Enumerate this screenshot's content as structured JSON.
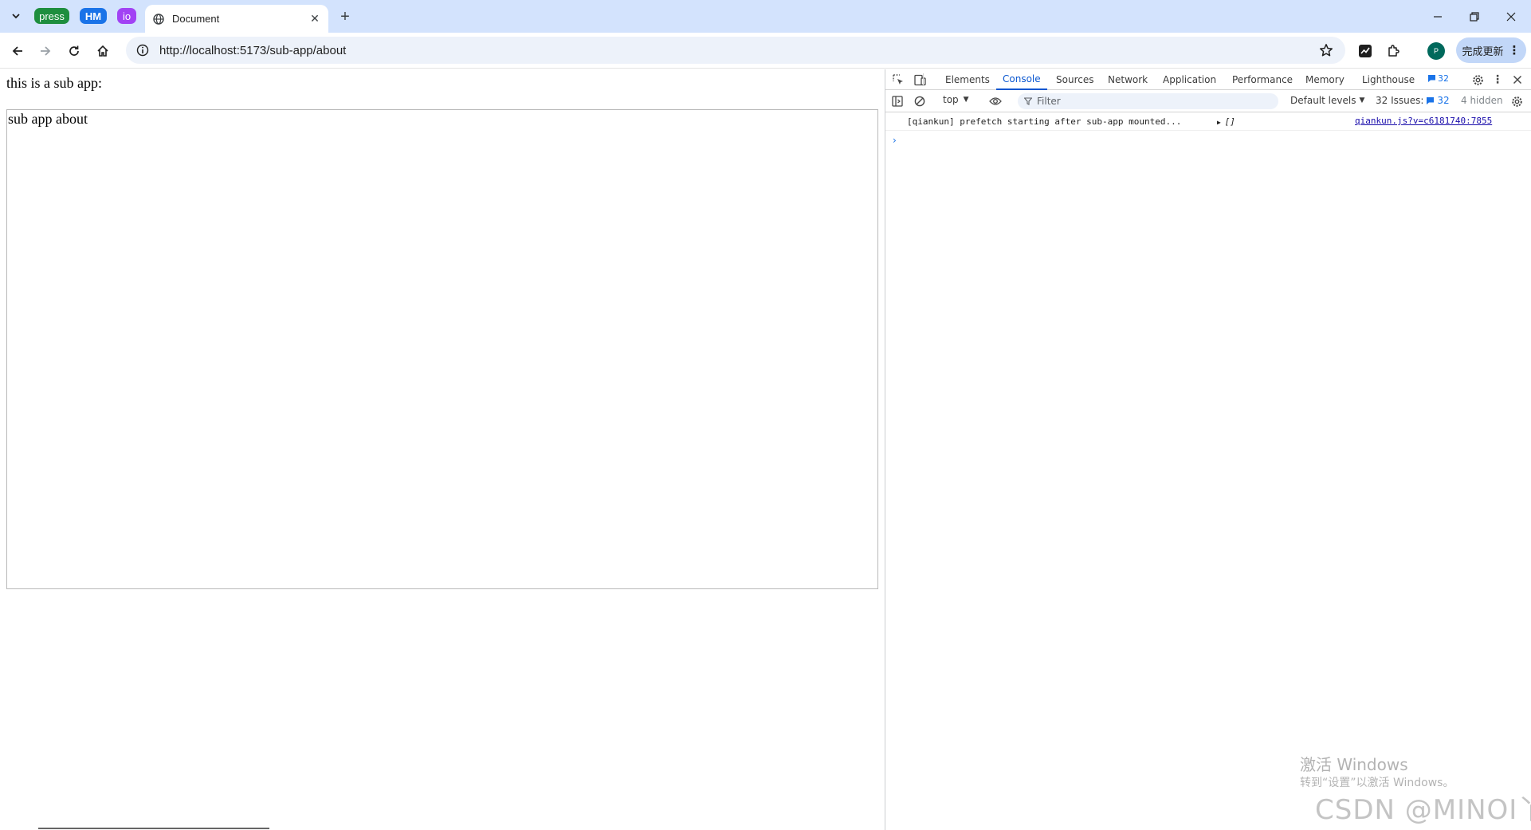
{
  "browser": {
    "pinned_tabs": [
      {
        "label": "press",
        "color": "#1e8e3e"
      },
      {
        "label": "HM",
        "color": "#1a73e8"
      },
      {
        "label": "io",
        "color": "#a142f4"
      }
    ],
    "active_tab": {
      "title": "Document",
      "icon": "globe-icon"
    },
    "url": "http://localhost:5173/sub-app/about",
    "profile_initial": "P",
    "update_button": "完成更新"
  },
  "page": {
    "heading": "this is a sub app:",
    "subapp_text": "sub app about"
  },
  "devtools": {
    "tabs": [
      "Elements",
      "Console",
      "Sources",
      "Network",
      "Application",
      "Performance",
      "Memory",
      "Lighthouse"
    ],
    "active_tab": "Console",
    "issues_badge": "32",
    "context": "top",
    "filter_placeholder": "Filter",
    "levels": "Default levels",
    "issues_label": "32 Issues:",
    "issues_number": "32",
    "hidden": "4 hidden",
    "messages": [
      {
        "text": "[qiankun] prefetch starting after sub-app mounted...",
        "value": "[]",
        "source": "qiankun.js?v=c6181740:7855"
      }
    ]
  },
  "watermarks": {
    "windows_title": "激活 Windows",
    "windows_sub": "转到“设置”以激活 Windows。",
    "csdn": "CSDN @MINOI丫"
  }
}
